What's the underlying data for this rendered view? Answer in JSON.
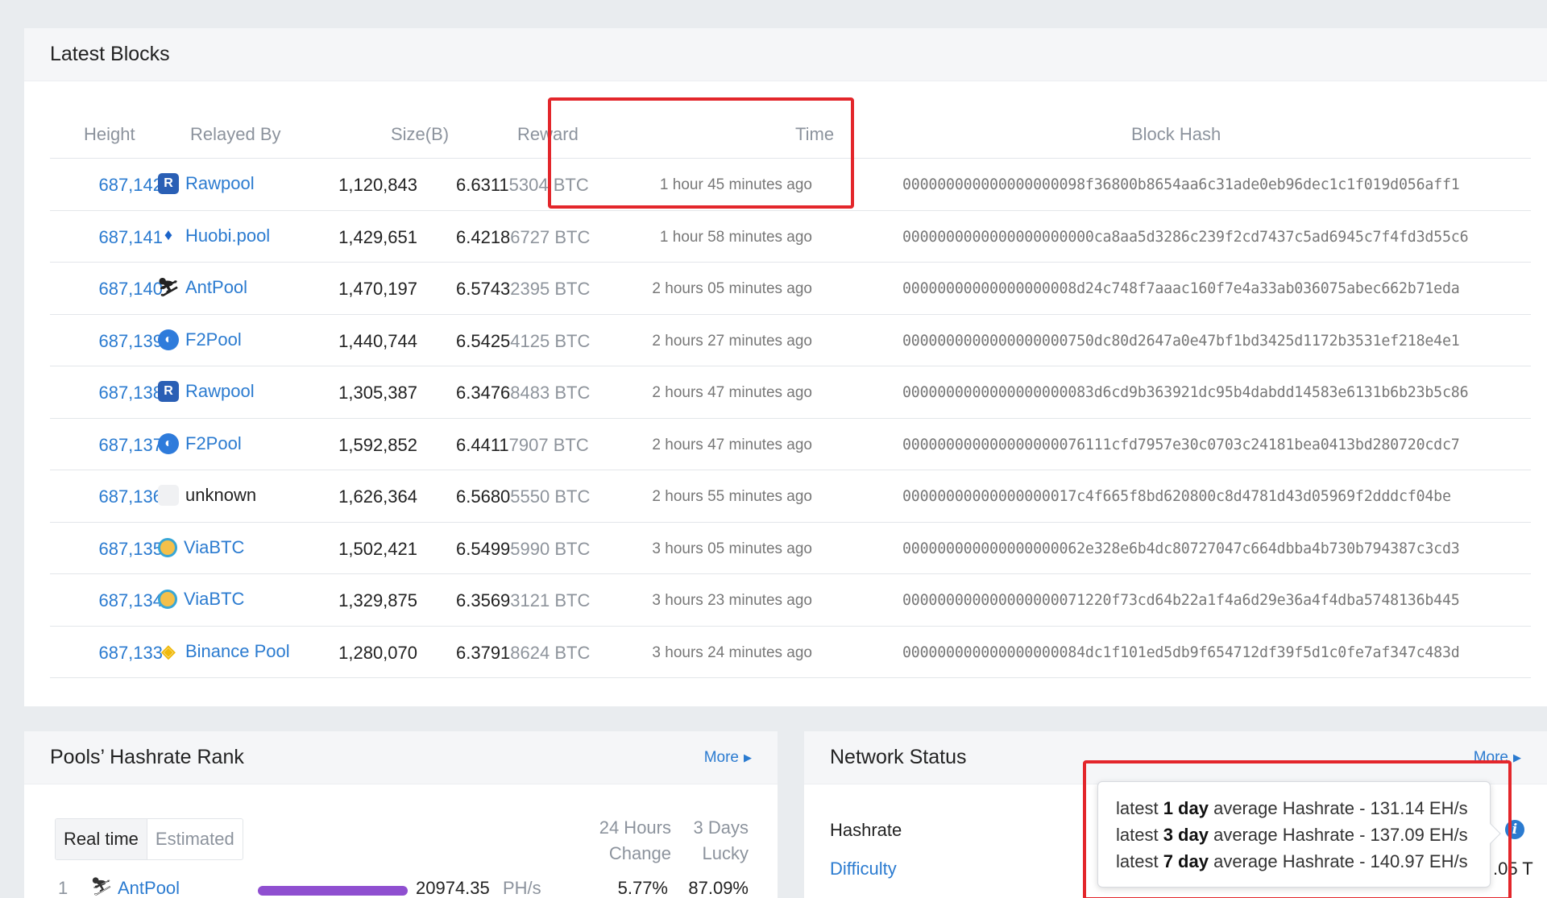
{
  "latest_blocks": {
    "title": "Latest Blocks",
    "columns": {
      "height": "Height",
      "relayed_by": "Relayed By",
      "size": "Size(B)",
      "reward": "Reward",
      "time": "Time",
      "hash": "Block Hash"
    },
    "rows": [
      {
        "height": "687,142",
        "pool": "Rawpool",
        "pool_icon": "rawpool-icon",
        "size": "1,120,843",
        "reward_main": "6.6311",
        "reward_rest": "5304 BTC",
        "time": "1 hour 45 minutes ago",
        "hash": "000000000000000000098f36800b8654aa6c31ade0eb96dec1c1f019d056aff1"
      },
      {
        "height": "687,141",
        "pool": "Huobi.pool",
        "pool_icon": "huobi-icon",
        "size": "1,429,651",
        "reward_main": "6.4218",
        "reward_rest": "6727 BTC",
        "time": "1 hour 58 minutes ago",
        "hash": "0000000000000000000000ca8aa5d3286c239f2cd7437c5ad6945c7f4fd3d55c6"
      },
      {
        "height": "687,140",
        "pool": "AntPool",
        "pool_icon": "antpool-icon",
        "size": "1,470,197",
        "reward_main": "6.5743",
        "reward_rest": "2395 BTC",
        "time": "2 hours 05 minutes ago",
        "hash": "00000000000000000008d24c748f7aaac160f7e4a33ab036075abec662b71eda"
      },
      {
        "height": "687,139",
        "pool": "F2Pool",
        "pool_icon": "f2pool-icon",
        "size": "1,440,744",
        "reward_main": "6.5425",
        "reward_rest": "4125 BTC",
        "time": "2 hours 27 minutes ago",
        "hash": "0000000000000000000750dc80d2647a0e47bf1bd3425d1172b3531ef218e4e1"
      },
      {
        "height": "687,138",
        "pool": "Rawpool",
        "pool_icon": "rawpool-icon",
        "size": "1,305,387",
        "reward_main": "6.3476",
        "reward_rest": "8483 BTC",
        "time": "2 hours 47 minutes ago",
        "hash": "0000000000000000000083d6cd9b363921dc95b4dabdd14583e6131b6b23b5c86"
      },
      {
        "height": "687,137",
        "pool": "F2Pool",
        "pool_icon": "f2pool-icon",
        "size": "1,592,852",
        "reward_main": "6.4411",
        "reward_rest": "7907 BTC",
        "time": "2 hours 47 minutes ago",
        "hash": "000000000000000000076111cfd7957e30c0703c24181bea0413bd280720cdc7"
      },
      {
        "height": "687,136",
        "pool": "unknown",
        "pool_icon": "unknown-pool-icon",
        "size": "1,626,364",
        "reward_main": "6.5680",
        "reward_rest": "5550 BTC",
        "time": "2 hours 55 minutes ago",
        "hash": "00000000000000000017c4f665f8bd620800c8d4781d43d05969f2dddcf04be"
      },
      {
        "height": "687,135",
        "pool": "ViaBTC",
        "pool_icon": "viabtc-icon",
        "size": "1,502,421",
        "reward_main": "6.5499",
        "reward_rest": "5990 BTC",
        "time": "3 hours 05 minutes ago",
        "hash": "000000000000000000062e328e6b4dc80727047c664dbba4b730b794387c3cd3"
      },
      {
        "height": "687,134",
        "pool": "ViaBTC",
        "pool_icon": "viabtc-icon",
        "size": "1,329,875",
        "reward_main": "6.3569",
        "reward_rest": "3121 BTC",
        "time": "3 hours 23 minutes ago",
        "hash": "000000000000000000071220f73cd64b22a1f4a6d29e36a4f4dba5748136b445"
      },
      {
        "height": "687,133",
        "pool": "Binance Pool",
        "pool_icon": "binance-pool-icon",
        "size": "1,280,070",
        "reward_main": "6.3791",
        "reward_rest": "8624 BTC",
        "time": "3 hours 24 minutes ago",
        "hash": "000000000000000000084dc1f101ed5db9f654712df39f5d1c0fe7af347c483d"
      }
    ]
  },
  "pools_rank": {
    "title": "Pools’ Hashrate Rank",
    "more": "More",
    "tabs": [
      "Real time",
      "Estimated"
    ],
    "col_change_line1": "24 Hours",
    "col_change_line2": "Change",
    "col_lucky_line1": "3 Days",
    "col_lucky_line2": "Lucky",
    "row": {
      "rank": "1",
      "name": "AntPool",
      "hashrate": "20974.35",
      "unit": "PH/s",
      "change": "5.77%",
      "lucky": "87.09%"
    }
  },
  "network_status": {
    "title": "Network Status",
    "more": "More",
    "hashrate_label": "Hashrate",
    "difficulty_label": "Difficulty",
    "difficulty_partial": ".05 T",
    "tooltip": [
      {
        "prefix": "latest ",
        "bold": "1 day",
        "suffix": " average Hashrate - 131.14 EH/s"
      },
      {
        "prefix": "latest ",
        "bold": "3 day",
        "suffix": " average Hashrate - 137.09 EH/s"
      },
      {
        "prefix": "latest ",
        "bold": "7 day",
        "suffix": " average Hashrate - 140.97 EH/s"
      }
    ]
  },
  "colors": {
    "link": "#2b7bd0",
    "highlight_box": "#e3262b",
    "bar": "#8f4fd0"
  }
}
